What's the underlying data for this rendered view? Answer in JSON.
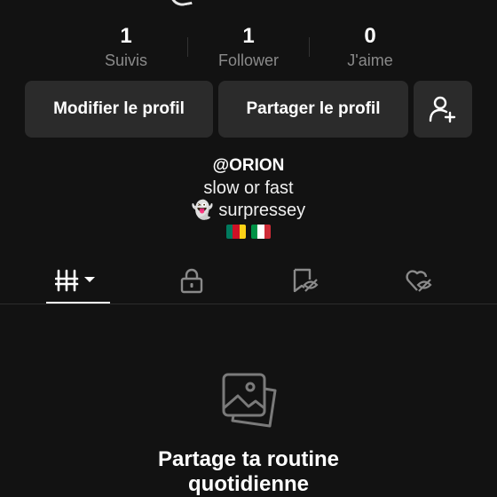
{
  "stats": [
    {
      "count": "1",
      "label": "Suivis"
    },
    {
      "count": "1",
      "label": "Follower"
    },
    {
      "count": "0",
      "label": "J'aime"
    }
  ],
  "actions": {
    "edit_profile": "Modifier le profil",
    "share_profile": "Partager le profil",
    "add_friend_icon": "person-plus-icon"
  },
  "profile": {
    "handle": "@ORION",
    "bio_line1": "slow or fast",
    "bio_line2": "👻 surpressey",
    "flags": [
      "Cameroon",
      "Italy"
    ]
  },
  "tabs": [
    {
      "icon": "grid-icon",
      "selected": true
    },
    {
      "icon": "lock-icon",
      "selected": false
    },
    {
      "icon": "bookmark-hidden-icon",
      "selected": false
    },
    {
      "icon": "heart-hidden-icon",
      "selected": false
    }
  ],
  "empty_state": {
    "icon": "photos-icon",
    "title_line1": "Partage ta routine",
    "title_line2": "quotidienne"
  },
  "colors": {
    "background": "#121212",
    "button": "#2b2b2b",
    "muted_text": "#8a8a8a",
    "cameroon": [
      "#007a5e",
      "#ce1126",
      "#fcd116"
    ],
    "italy": [
      "#009246",
      "#ffffff",
      "#ce2b37"
    ]
  }
}
